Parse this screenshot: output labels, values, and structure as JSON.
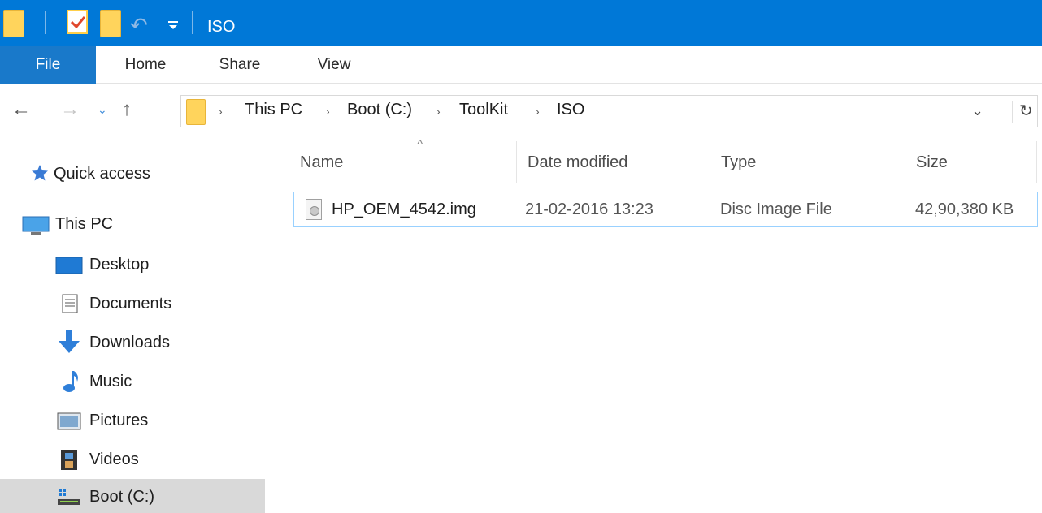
{
  "window": {
    "title": "ISO"
  },
  "ribbon": {
    "tabs": [
      "File",
      "Home",
      "Share",
      "View"
    ]
  },
  "address": {
    "breadcrumbs": [
      "This PC",
      "Boot (C:)",
      "ToolKit",
      "ISO"
    ],
    "separator": "›"
  },
  "nav": {
    "quick_access": "Quick access",
    "this_pc": "This PC",
    "items": [
      {
        "label": "Desktop",
        "icon": "desktop-icon"
      },
      {
        "label": "Documents",
        "icon": "documents-icon"
      },
      {
        "label": "Downloads",
        "icon": "downloads-icon"
      },
      {
        "label": "Music",
        "icon": "music-icon"
      },
      {
        "label": "Pictures",
        "icon": "pictures-icon"
      },
      {
        "label": "Videos",
        "icon": "videos-icon"
      },
      {
        "label": "Boot (C:)",
        "icon": "drive-icon",
        "selected": true
      }
    ]
  },
  "columns": {
    "name": "Name",
    "date": "Date modified",
    "type": "Type",
    "size": "Size"
  },
  "files": [
    {
      "name": "HP_OEM_4542.img",
      "date": "21-02-2016 13:23",
      "type": "Disc Image File",
      "size": "42,90,380 KB"
    }
  ],
  "colors": {
    "titlebar": "#0078d7",
    "file_tab": "#1979ca",
    "selection_border": "#99d1ff",
    "nav_selected": "#d9d9d9"
  }
}
